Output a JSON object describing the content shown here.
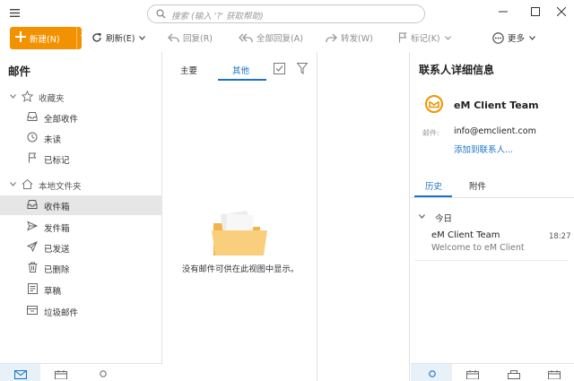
{
  "titlebar": {
    "search_placeholder": "搜索 (输入 '?' 获取帮助)"
  },
  "toolbar": {
    "new_label": "新建(N)",
    "refresh_label": "刷新(E)",
    "reply_label": "回复(R)",
    "reply_all_label": "全部回复(A)",
    "forward_label": "转发(W)",
    "flag_label": "标记(K)",
    "more_label": "更多"
  },
  "left": {
    "title": "邮件",
    "favorites_label": "收藏夹",
    "favorites": [
      "全部收件",
      "未读",
      "已标记"
    ],
    "local_label": "本地文件夹",
    "local": [
      "收件箱",
      "发件箱",
      "已发送",
      "已删除",
      "草稿",
      "垃圾邮件"
    ]
  },
  "middle": {
    "tab_main": "主要",
    "tab_other": "其他",
    "empty_message": "没有邮件可供在此视图中显示。"
  },
  "right": {
    "title": "联系人详细信息",
    "contact_name": "eM Client Team",
    "email_label": "邮件:",
    "email_value": "info@emclient.com",
    "add_contact": "添加到联系人...",
    "tab_history": "历史",
    "tab_attachments": "附件",
    "group_today": "今日",
    "message": {
      "sender": "eM Client Team",
      "time": "18:27",
      "subject": "Welcome to eM Client"
    }
  },
  "colors": {
    "accent": "#f39200",
    "link": "#1a73c9",
    "selected_bg": "#e6e6e6",
    "folder": "#f6c66b"
  }
}
